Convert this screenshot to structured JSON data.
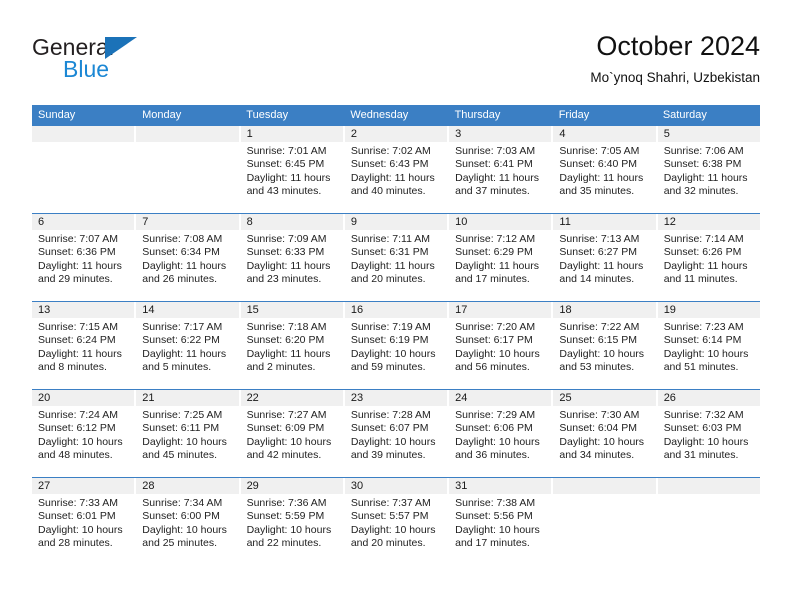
{
  "brand": {
    "name_part1": "General",
    "name_part2": "Blue",
    "logo_icon": "triangle-logo-icon"
  },
  "header": {
    "title": "October 2024",
    "subtitle": "Mo`ynoq Shahri, Uzbekistan"
  },
  "calendar": {
    "weekdays": [
      "Sunday",
      "Monday",
      "Tuesday",
      "Wednesday",
      "Thursday",
      "Friday",
      "Saturday"
    ],
    "accent_color": "#3b7fc4",
    "day_band_color": "#f0f0f0",
    "weeks": [
      [
        {
          "day": "",
          "sunrise": "",
          "sunset": "",
          "daylight_line1": "",
          "daylight_line2": ""
        },
        {
          "day": "",
          "sunrise": "",
          "sunset": "",
          "daylight_line1": "",
          "daylight_line2": ""
        },
        {
          "day": "1",
          "sunrise": "Sunrise: 7:01 AM",
          "sunset": "Sunset: 6:45 PM",
          "daylight_line1": "Daylight: 11 hours",
          "daylight_line2": "and 43 minutes."
        },
        {
          "day": "2",
          "sunrise": "Sunrise: 7:02 AM",
          "sunset": "Sunset: 6:43 PM",
          "daylight_line1": "Daylight: 11 hours",
          "daylight_line2": "and 40 minutes."
        },
        {
          "day": "3",
          "sunrise": "Sunrise: 7:03 AM",
          "sunset": "Sunset: 6:41 PM",
          "daylight_line1": "Daylight: 11 hours",
          "daylight_line2": "and 37 minutes."
        },
        {
          "day": "4",
          "sunrise": "Sunrise: 7:05 AM",
          "sunset": "Sunset: 6:40 PM",
          "daylight_line1": "Daylight: 11 hours",
          "daylight_line2": "and 35 minutes."
        },
        {
          "day": "5",
          "sunrise": "Sunrise: 7:06 AM",
          "sunset": "Sunset: 6:38 PM",
          "daylight_line1": "Daylight: 11 hours",
          "daylight_line2": "and 32 minutes."
        }
      ],
      [
        {
          "day": "6",
          "sunrise": "Sunrise: 7:07 AM",
          "sunset": "Sunset: 6:36 PM",
          "daylight_line1": "Daylight: 11 hours",
          "daylight_line2": "and 29 minutes."
        },
        {
          "day": "7",
          "sunrise": "Sunrise: 7:08 AM",
          "sunset": "Sunset: 6:34 PM",
          "daylight_line1": "Daylight: 11 hours",
          "daylight_line2": "and 26 minutes."
        },
        {
          "day": "8",
          "sunrise": "Sunrise: 7:09 AM",
          "sunset": "Sunset: 6:33 PM",
          "daylight_line1": "Daylight: 11 hours",
          "daylight_line2": "and 23 minutes."
        },
        {
          "day": "9",
          "sunrise": "Sunrise: 7:11 AM",
          "sunset": "Sunset: 6:31 PM",
          "daylight_line1": "Daylight: 11 hours",
          "daylight_line2": "and 20 minutes."
        },
        {
          "day": "10",
          "sunrise": "Sunrise: 7:12 AM",
          "sunset": "Sunset: 6:29 PM",
          "daylight_line1": "Daylight: 11 hours",
          "daylight_line2": "and 17 minutes."
        },
        {
          "day": "11",
          "sunrise": "Sunrise: 7:13 AM",
          "sunset": "Sunset: 6:27 PM",
          "daylight_line1": "Daylight: 11 hours",
          "daylight_line2": "and 14 minutes."
        },
        {
          "day": "12",
          "sunrise": "Sunrise: 7:14 AM",
          "sunset": "Sunset: 6:26 PM",
          "daylight_line1": "Daylight: 11 hours",
          "daylight_line2": "and 11 minutes."
        }
      ],
      [
        {
          "day": "13",
          "sunrise": "Sunrise: 7:15 AM",
          "sunset": "Sunset: 6:24 PM",
          "daylight_line1": "Daylight: 11 hours",
          "daylight_line2": "and 8 minutes."
        },
        {
          "day": "14",
          "sunrise": "Sunrise: 7:17 AM",
          "sunset": "Sunset: 6:22 PM",
          "daylight_line1": "Daylight: 11 hours",
          "daylight_line2": "and 5 minutes."
        },
        {
          "day": "15",
          "sunrise": "Sunrise: 7:18 AM",
          "sunset": "Sunset: 6:20 PM",
          "daylight_line1": "Daylight: 11 hours",
          "daylight_line2": "and 2 minutes."
        },
        {
          "day": "16",
          "sunrise": "Sunrise: 7:19 AM",
          "sunset": "Sunset: 6:19 PM",
          "daylight_line1": "Daylight: 10 hours",
          "daylight_line2": "and 59 minutes."
        },
        {
          "day": "17",
          "sunrise": "Sunrise: 7:20 AM",
          "sunset": "Sunset: 6:17 PM",
          "daylight_line1": "Daylight: 10 hours",
          "daylight_line2": "and 56 minutes."
        },
        {
          "day": "18",
          "sunrise": "Sunrise: 7:22 AM",
          "sunset": "Sunset: 6:15 PM",
          "daylight_line1": "Daylight: 10 hours",
          "daylight_line2": "and 53 minutes."
        },
        {
          "day": "19",
          "sunrise": "Sunrise: 7:23 AM",
          "sunset": "Sunset: 6:14 PM",
          "daylight_line1": "Daylight: 10 hours",
          "daylight_line2": "and 51 minutes."
        }
      ],
      [
        {
          "day": "20",
          "sunrise": "Sunrise: 7:24 AM",
          "sunset": "Sunset: 6:12 PM",
          "daylight_line1": "Daylight: 10 hours",
          "daylight_line2": "and 48 minutes."
        },
        {
          "day": "21",
          "sunrise": "Sunrise: 7:25 AM",
          "sunset": "Sunset: 6:11 PM",
          "daylight_line1": "Daylight: 10 hours",
          "daylight_line2": "and 45 minutes."
        },
        {
          "day": "22",
          "sunrise": "Sunrise: 7:27 AM",
          "sunset": "Sunset: 6:09 PM",
          "daylight_line1": "Daylight: 10 hours",
          "daylight_line2": "and 42 minutes."
        },
        {
          "day": "23",
          "sunrise": "Sunrise: 7:28 AM",
          "sunset": "Sunset: 6:07 PM",
          "daylight_line1": "Daylight: 10 hours",
          "daylight_line2": "and 39 minutes."
        },
        {
          "day": "24",
          "sunrise": "Sunrise: 7:29 AM",
          "sunset": "Sunset: 6:06 PM",
          "daylight_line1": "Daylight: 10 hours",
          "daylight_line2": "and 36 minutes."
        },
        {
          "day": "25",
          "sunrise": "Sunrise: 7:30 AM",
          "sunset": "Sunset: 6:04 PM",
          "daylight_line1": "Daylight: 10 hours",
          "daylight_line2": "and 34 minutes."
        },
        {
          "day": "26",
          "sunrise": "Sunrise: 7:32 AM",
          "sunset": "Sunset: 6:03 PM",
          "daylight_line1": "Daylight: 10 hours",
          "daylight_line2": "and 31 minutes."
        }
      ],
      [
        {
          "day": "27",
          "sunrise": "Sunrise: 7:33 AM",
          "sunset": "Sunset: 6:01 PM",
          "daylight_line1": "Daylight: 10 hours",
          "daylight_line2": "and 28 minutes."
        },
        {
          "day": "28",
          "sunrise": "Sunrise: 7:34 AM",
          "sunset": "Sunset: 6:00 PM",
          "daylight_line1": "Daylight: 10 hours",
          "daylight_line2": "and 25 minutes."
        },
        {
          "day": "29",
          "sunrise": "Sunrise: 7:36 AM",
          "sunset": "Sunset: 5:59 PM",
          "daylight_line1": "Daylight: 10 hours",
          "daylight_line2": "and 22 minutes."
        },
        {
          "day": "30",
          "sunrise": "Sunrise: 7:37 AM",
          "sunset": "Sunset: 5:57 PM",
          "daylight_line1": "Daylight: 10 hours",
          "daylight_line2": "and 20 minutes."
        },
        {
          "day": "31",
          "sunrise": "Sunrise: 7:38 AM",
          "sunset": "Sunset: 5:56 PM",
          "daylight_line1": "Daylight: 10 hours",
          "daylight_line2": "and 17 minutes."
        },
        {
          "day": "",
          "sunrise": "",
          "sunset": "",
          "daylight_line1": "",
          "daylight_line2": ""
        },
        {
          "day": "",
          "sunrise": "",
          "sunset": "",
          "daylight_line1": "",
          "daylight_line2": ""
        }
      ]
    ]
  }
}
